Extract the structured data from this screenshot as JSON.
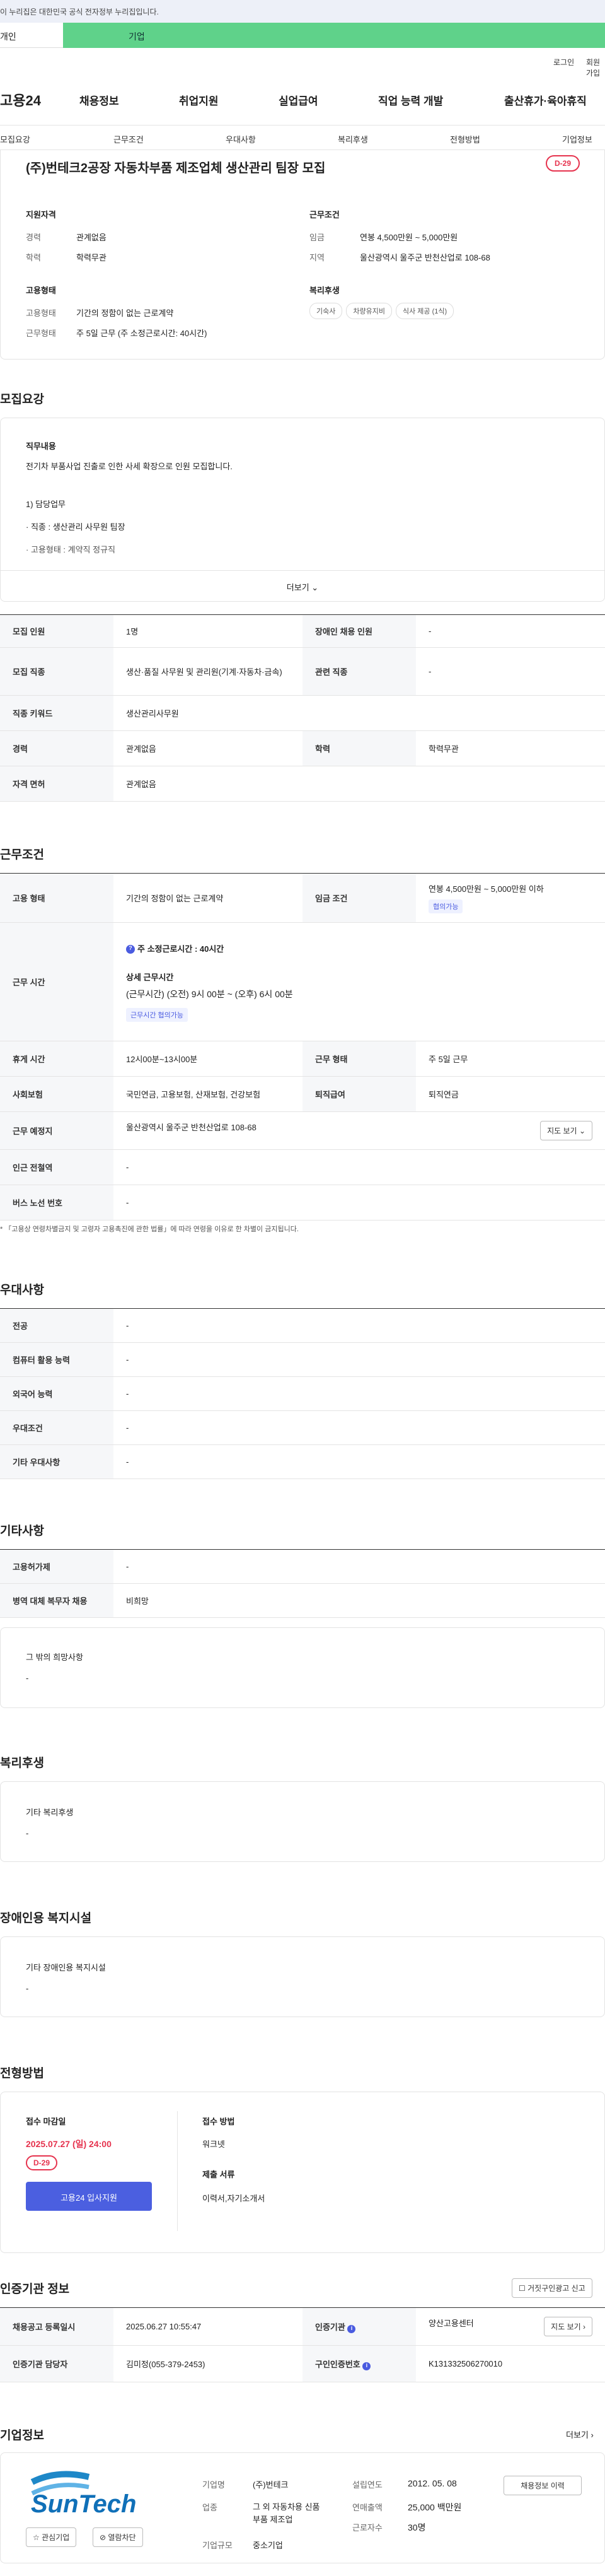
{
  "gov_bar": {
    "text": "이 누리집은 대한민국 공식 전자정부 누리집입니다."
  },
  "tabs": {
    "personal": "개인",
    "company": "기업"
  },
  "util": {
    "login": "로그인",
    "join": "회원가입"
  },
  "logo": "고용24",
  "main_nav": [
    "채용정보",
    "취업지원",
    "실업급여",
    "직업 능력 개발",
    "출산휴가·육아휴직"
  ],
  "sub_nav": [
    "모집요강",
    "근무조건",
    "우대사항",
    "복리후생",
    "전형방법",
    "기업정보"
  ],
  "job": {
    "title": "(주)번테크2공장 자동차부품 제조업체 생산관리 팀장 모집",
    "dday": "D-29",
    "qual_title": "지원자격",
    "qual": [
      {
        "label": "경력",
        "value": "관계없음"
      },
      {
        "label": "학력",
        "value": "학력무관"
      }
    ],
    "cond_title": "근무조건",
    "cond": [
      {
        "label": "임금",
        "value": "연봉 4,500만원 ~ 5,000만원"
      },
      {
        "label": "지역",
        "value": "울산광역시 울주군 반천산업로 108-68"
      }
    ],
    "emp_title": "고용형태",
    "emp": [
      {
        "label": "고용형태",
        "value": "기간의 정함이 없는 근로계약"
      },
      {
        "label": "근무형태",
        "value": "주 5일 근무 (주 소정근로시간: 40시간)"
      }
    ],
    "welfare_title": "복리후생",
    "welfare_chips": [
      "기숙사",
      "차량유지비",
      "식사 제공 (1식)"
    ]
  },
  "recruit": {
    "section": "모집요강",
    "content_title": "직무내용",
    "content_lines": [
      "전기차 부품사업 진출로 인한 사세 확장으로 인원 모집합니다.",
      "",
      "1) 담당업무",
      " · 직종 : 생산관리 사무원 팀장",
      " · 고용형태 : 계약직 정규직"
    ],
    "more": "더보기",
    "rows": [
      {
        "h1": "모집 인원",
        "v1": "1명",
        "h2": "장애인 채용 인원",
        "v2": "-"
      },
      {
        "h1": "모집 직종",
        "v1": "생산·품질 사무원 및 관리원(기계·자동차·금속)",
        "h2": "관련 직종",
        "v2": "-"
      },
      {
        "h1": "직종 키워드",
        "v1": "생산관리사무원"
      },
      {
        "h1": "경력",
        "v1": "관계없음",
        "h2": "학력",
        "v2": "학력무관"
      },
      {
        "h1": "자격 면허",
        "v1": "관계없음"
      }
    ]
  },
  "work": {
    "section": "근무조건",
    "emp_type_h": "고용 형태",
    "emp_type_v": "기간의 정함이 없는 근로계약",
    "wage_h": "임금 조건",
    "wage_v": "연봉 4,500만원 ~ 5,000만원 이하",
    "wage_badge": "협의가능",
    "hours_h": "근무 시간",
    "hours_main": "주 소정근로시간 : 40시간",
    "hours_detail_title": "상세 근무시간",
    "hours_detail": "(근무시간) (오전) 9시 00분 ~ (오후) 6시 00분",
    "hours_badge": "근무시간 협의가능",
    "break_h": "휴게 시간",
    "break_v": "12시00분~13시00분",
    "shift_h": "근무 형태",
    "shift_v": "주 5일 근무",
    "ins_h": "사회보험",
    "ins_v": "국민연금, 고용보험, 산재보험, 건강보험",
    "ret_h": "퇴직급여",
    "ret_v": "퇴직연금",
    "place_h": "근무 예정지",
    "place_v": "울산광역시 울주군 반천산업로 108-68",
    "map_btn": "지도 보기",
    "sub_h": "인근 전철역",
    "sub_v": "-",
    "bus_h": "버스 노선 번호",
    "bus_v": "-",
    "note": "「고용상 연령차별금지 및 고령자 고용촉진에 관한 법률」에 따라 연령을 이유로 한 차별이 금지됩니다."
  },
  "pref": {
    "section": "우대사항",
    "rows": [
      {
        "h": "전공",
        "v": "-"
      },
      {
        "h": "컴퓨터 활용 능력",
        "v": "-"
      },
      {
        "h": "외국어 능력",
        "v": "-"
      },
      {
        "h": "우대조건",
        "v": "-"
      },
      {
        "h": "기타 우대사항",
        "v": "-"
      }
    ]
  },
  "etc": {
    "section": "기타사항",
    "rows": [
      {
        "h": "고용허가제",
        "v": "-"
      },
      {
        "h": "병역 대체 복무자 채용",
        "v": "비희망"
      }
    ],
    "box_title": "그 밖의 희망사항",
    "box_value": "-"
  },
  "welfare": {
    "section": "복리후생",
    "box_title": "기타 복리후생",
    "box_value": "-"
  },
  "disab": {
    "section": "장애인용 복지시설",
    "box_title": "기타 장애인용 복지시설",
    "box_value": "-"
  },
  "process": {
    "section": "전형방법",
    "deadline_title": "접수 마감일",
    "deadline": "2025.07.27 (일) 24:00",
    "dday": "D-29",
    "apply_btn": "고용24 입사지원",
    "method_title": "접수 방법",
    "method": "워크넷",
    "docs_title": "제출 서류",
    "docs": "이력서,자기소개서"
  },
  "cert": {
    "section": "인증기관 정보",
    "report_btn": "거짓구인광고 신고",
    "r1h1": "채용공고 등록일시",
    "r1v1": "2025.06.27 10:55:47",
    "r1h2": "인증기관",
    "r1v2": "양산고용센터",
    "r1btn": "지도 보기",
    "r2h1": "인증기관 담당자",
    "r2v1": "김미정(055-379-2453)",
    "r2h2": "구인인증번호",
    "r2v2": "K131332506270010"
  },
  "company": {
    "section": "기업정보",
    "more": "더보기",
    "logo_text": "SunTech",
    "fav_btn": "관심기업",
    "block_btn": "열람차단",
    "name_h": "기업명",
    "name_v": "(주)번테크",
    "ind_h": "업종",
    "ind_v": "그 외 자동차용 신품 부품 제조업",
    "size_h": "기업규모",
    "size_v": "중소기업",
    "est_h": "설립연도",
    "est_v": "2012. 05. 08",
    "sales_h": "연매출액",
    "sales_v": "25,000 백만원",
    "emp_h": "근로자수",
    "emp_v": "30명",
    "jobs_btn": "채용정보 이력"
  }
}
